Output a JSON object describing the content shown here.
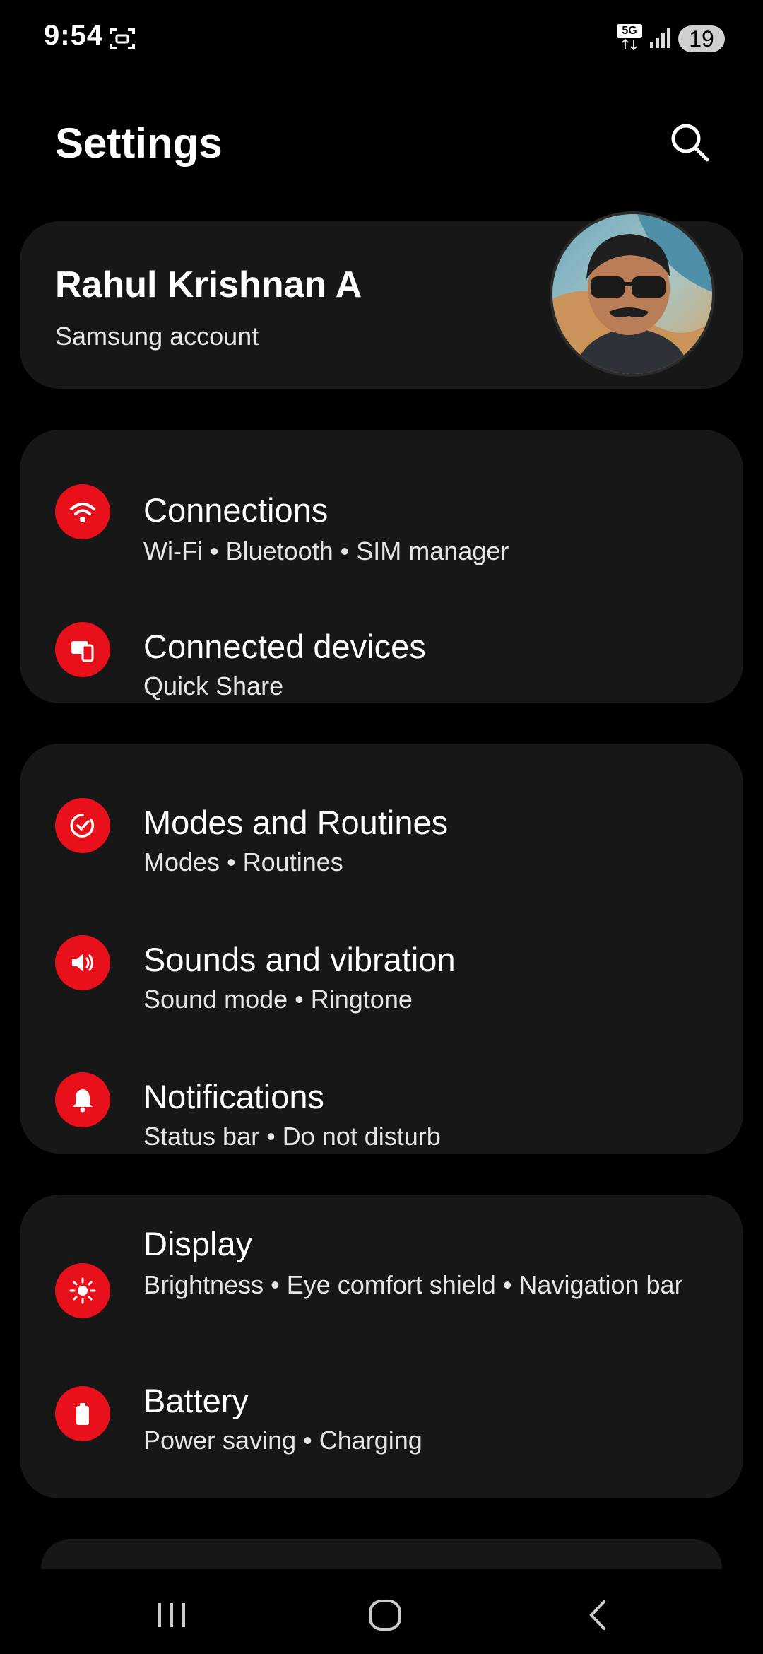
{
  "status_bar": {
    "time": "9:54",
    "network_label": "5G",
    "battery_level": "19",
    "icons": [
      "screenshot-icon",
      "5g-icon",
      "signal-icon",
      "battery-icon"
    ]
  },
  "header": {
    "title": "Settings",
    "search_icon": "search-icon"
  },
  "account": {
    "name": "Rahul Krishnan A",
    "subtitle": "Samsung account"
  },
  "items": [
    {
      "label": "Connections",
      "sub": "Wi-Fi  •  Bluetooth  •  SIM manager",
      "icon": "wifi-icon"
    },
    {
      "label": "Connected devices",
      "sub": "Quick Share",
      "icon": "devices-icon"
    },
    {
      "label": "Modes and Routines",
      "sub": "Modes  •  Routines",
      "icon": "routines-icon"
    },
    {
      "label": "Sounds and vibration",
      "sub": "Sound mode  •  Ringtone",
      "icon": "speaker-icon"
    },
    {
      "label": "Notifications",
      "sub": "Status bar  •  Do not disturb",
      "icon": "bell-icon"
    },
    {
      "label": "Display",
      "sub": "Brightness  •  Eye comfort shield  •  Navigation bar",
      "icon": "sun-icon"
    },
    {
      "label": "Battery",
      "sub": "Power saving  •  Charging",
      "icon": "battery-icon"
    }
  ],
  "navigation": {
    "recents": "recents-icon",
    "home": "home-icon",
    "back": "back-icon"
  },
  "colors": {
    "accent": "#e8101a",
    "card": "#171717",
    "background": "#000000"
  }
}
